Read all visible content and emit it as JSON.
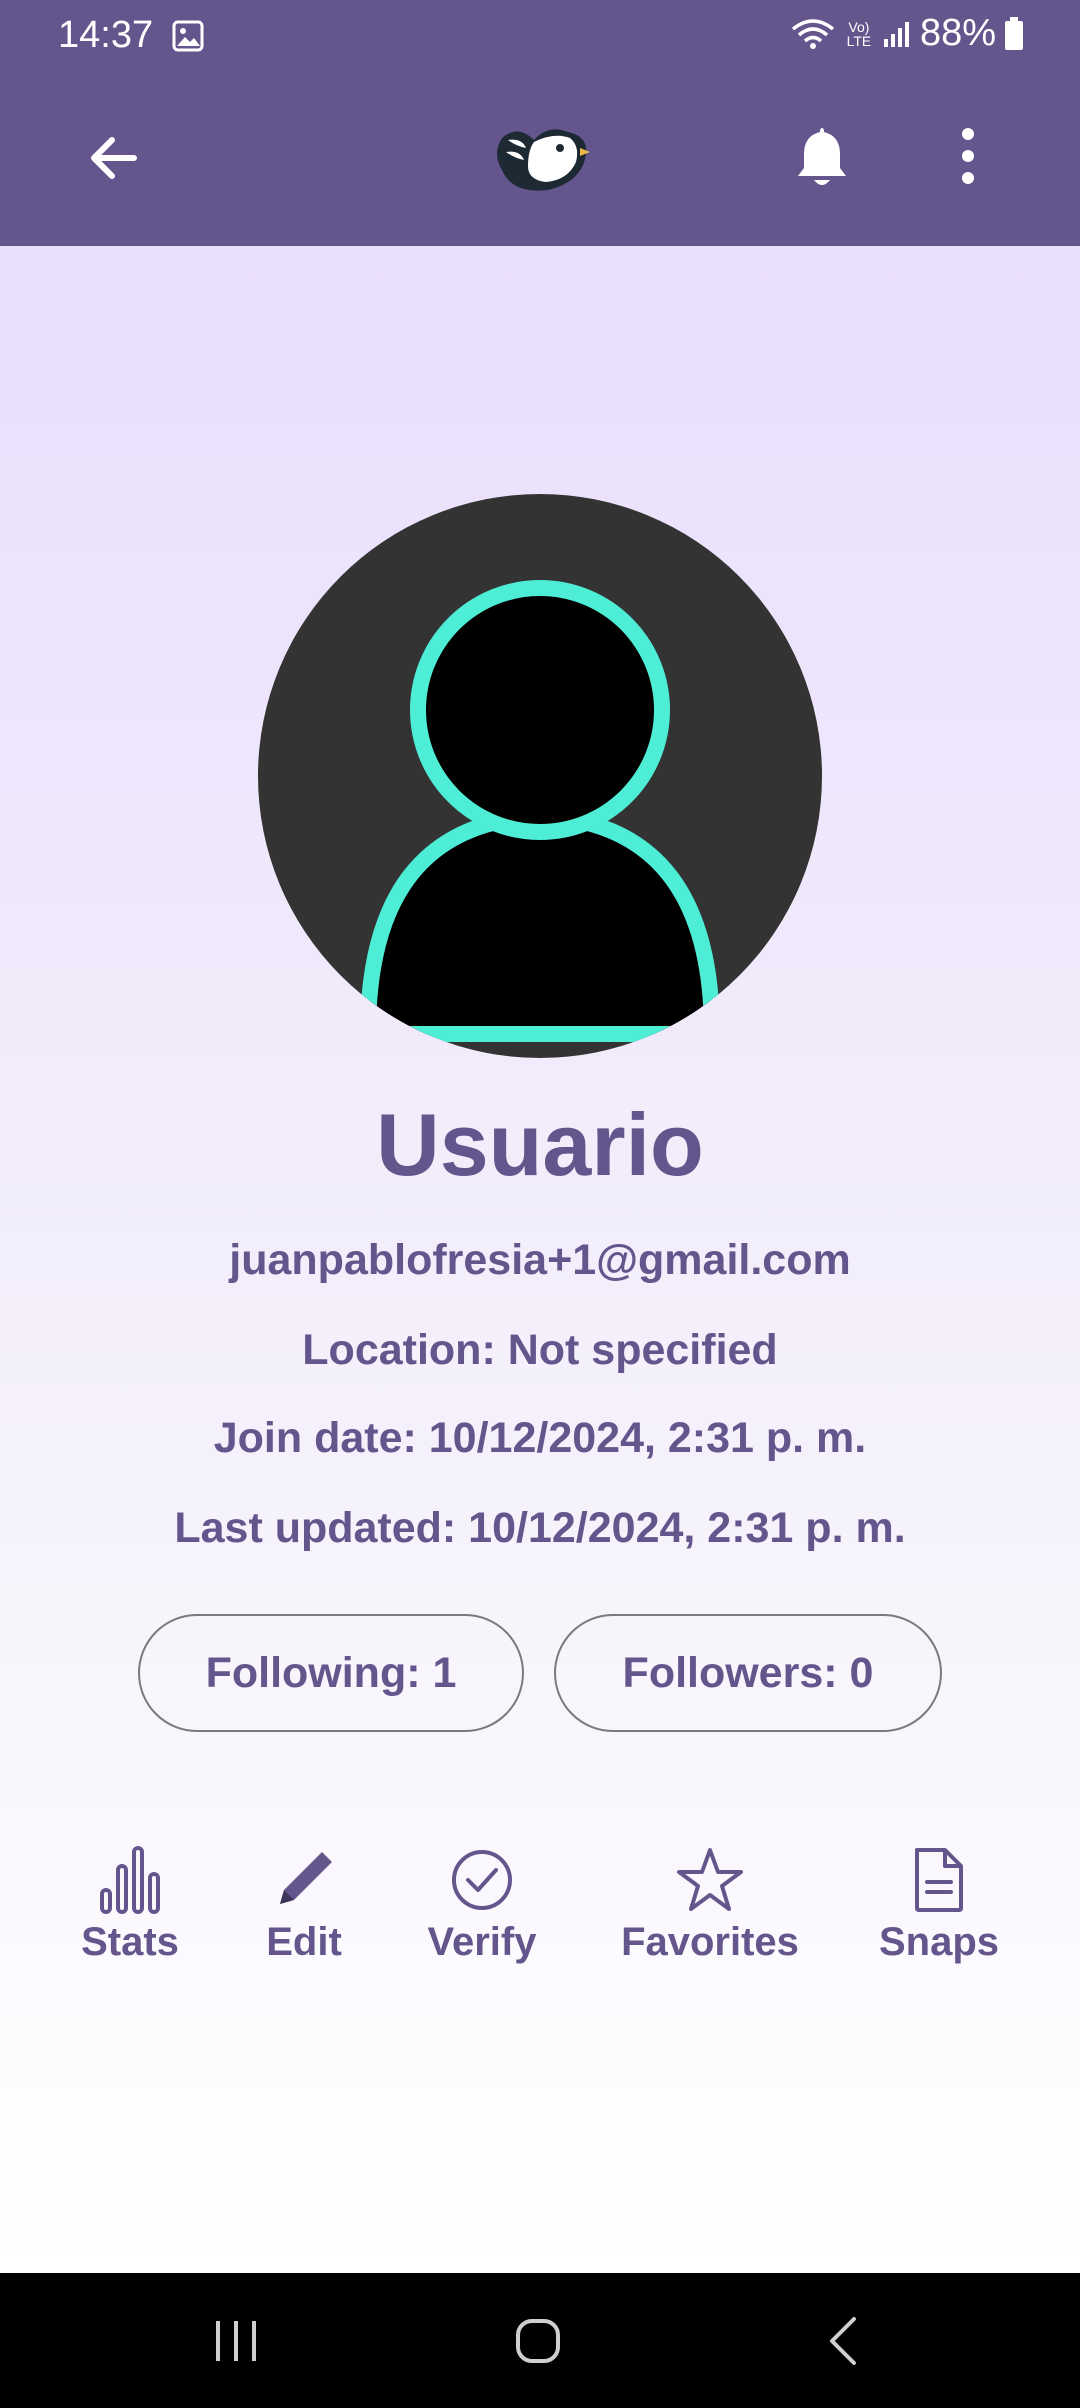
{
  "status": {
    "time": "14:37",
    "battery": "88%",
    "network_label": "Vo) LTE"
  },
  "app_bar": {
    "back_icon": "arrow-left-icon",
    "logo_icon": "bird-logo-icon",
    "bell_icon": "bell-icon",
    "more_icon": "more-vertical-icon"
  },
  "profile": {
    "name": "Usuario",
    "email": "juanpablofresia+1@gmail.com",
    "location": "Location: Not specified",
    "join_date": "Join date: 10/12/2024, 2:31 p. m.",
    "last_updated": "Last updated: 10/12/2024, 2:31 p. m."
  },
  "counts": {
    "following": "Following: 1",
    "followers": "Followers: 0"
  },
  "actions": [
    {
      "label": "Stats",
      "icon": "bar-chart-icon"
    },
    {
      "label": "Edit",
      "icon": "pencil-icon"
    },
    {
      "label": "Verify",
      "icon": "check-circle-icon"
    },
    {
      "label": "Favorites",
      "icon": "star-icon"
    },
    {
      "label": "Snaps",
      "icon": "document-icon"
    }
  ],
  "colors": {
    "brand": "#64568c",
    "avatar_bg": "#333333",
    "avatar_outline": "#4dedd6"
  }
}
